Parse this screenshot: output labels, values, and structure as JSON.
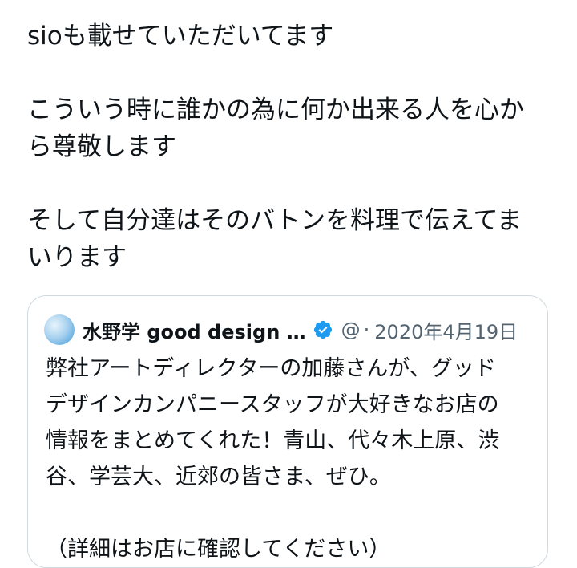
{
  "tweet": {
    "paragraphs": [
      [
        "sioも載せていただいてます"
      ],
      [
        "こういう時に誰かの為に何か出来る人を心か",
        "ら尊敬します"
      ],
      [
        "そして自分達はそのバトンを料理で伝えてま",
        "いります"
      ]
    ]
  },
  "quote": {
    "display_name": "水野学 good design …",
    "handle": "@",
    "separator": "·",
    "date": "2020年4月19日",
    "lines": [
      "弊社アートディレクターの加藤さんが、グッド",
      "デザインカンパニースタッフが大好きなお店の",
      "情報をまとめてくれた！青山、代々木上原、渋",
      "谷、学芸大、近郊の皆さま、ぜひ。",
      "（詳細はお店に確認してください）"
    ],
    "verified_color": "#1d9bf0"
  }
}
